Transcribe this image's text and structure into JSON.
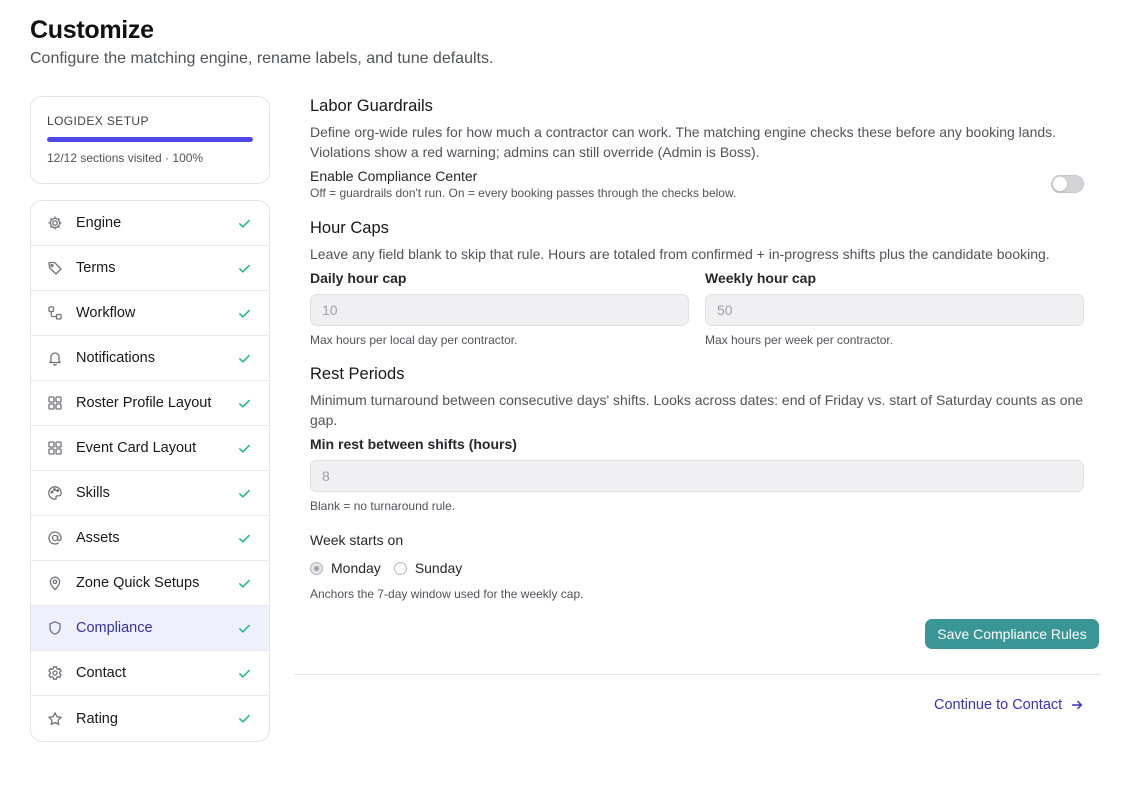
{
  "header": {
    "title": "Customize",
    "subtitle": "Configure the matching engine, rename labels, and tune defaults."
  },
  "progress": {
    "label": "LOGIDEX SETUP",
    "percent": 100,
    "status": "12/12 sections visited · 100%",
    "color": "#4f46e5"
  },
  "sidebar": {
    "items": [
      {
        "label": "Engine",
        "icon": "gear-icon",
        "done": true
      },
      {
        "label": "Terms",
        "icon": "tag-icon",
        "done": true
      },
      {
        "label": "Workflow",
        "icon": "workflow-icon",
        "done": true
      },
      {
        "label": "Notifications",
        "icon": "bell-icon",
        "done": true
      },
      {
        "label": "Roster Profile Layout",
        "icon": "layout-grid-icon",
        "done": true
      },
      {
        "label": "Event Card Layout",
        "icon": "layout-grid-icon",
        "done": true
      },
      {
        "label": "Skills",
        "icon": "palette-icon",
        "done": true
      },
      {
        "label": "Assets",
        "icon": "at-sign-icon",
        "done": true
      },
      {
        "label": "Zone Quick Setups",
        "icon": "map-pin-icon",
        "done": true
      },
      {
        "label": "Compliance",
        "icon": "shield-icon",
        "done": true,
        "active": true
      },
      {
        "label": "Contact",
        "icon": "settings-icon",
        "done": true
      },
      {
        "label": "Rating",
        "icon": "star-icon",
        "done": true
      }
    ],
    "active_color": "#eef0fd",
    "check_color": "#10b981"
  },
  "guardrails": {
    "title": "Labor Guardrails",
    "description": "Define org-wide rules for how much a contractor can work. The matching engine checks these before any booking lands. Violations show a red warning; admins can still override (Admin is Boss).",
    "toggle_label": "Enable Compliance Center",
    "toggle_help": "Off = guardrails don't run. On = every booking passes through the checks below.",
    "toggle_on": false
  },
  "hour_caps": {
    "title": "Hour Caps",
    "description": "Leave any field blank to skip that rule. Hours are totaled from confirmed + in-progress shifts plus the candidate booking.",
    "daily": {
      "label": "Daily hour cap",
      "placeholder": "10",
      "help": "Max hours per local day per contractor."
    },
    "weekly": {
      "label": "Weekly hour cap",
      "placeholder": "50",
      "help": "Max hours per week per contractor."
    }
  },
  "rest_periods": {
    "title": "Rest Periods",
    "description": "Minimum turnaround between consecutive days' shifts. Looks across dates: end of Friday vs. start of Saturday counts as one gap.",
    "min_rest": {
      "label": "Min rest between shifts (hours)",
      "placeholder": "8",
      "help": "Blank = no turnaround rule."
    }
  },
  "week_start": {
    "label": "Week starts on",
    "options": [
      "Monday",
      "Sunday"
    ],
    "selected": "Monday",
    "help": "Anchors the 7-day window used for the weekly cap."
  },
  "actions": {
    "save_label": "Save Compliance Rules",
    "save_color": "#3a9696",
    "continue_label": "Continue to Contact",
    "continue_color": "#3730c9"
  }
}
